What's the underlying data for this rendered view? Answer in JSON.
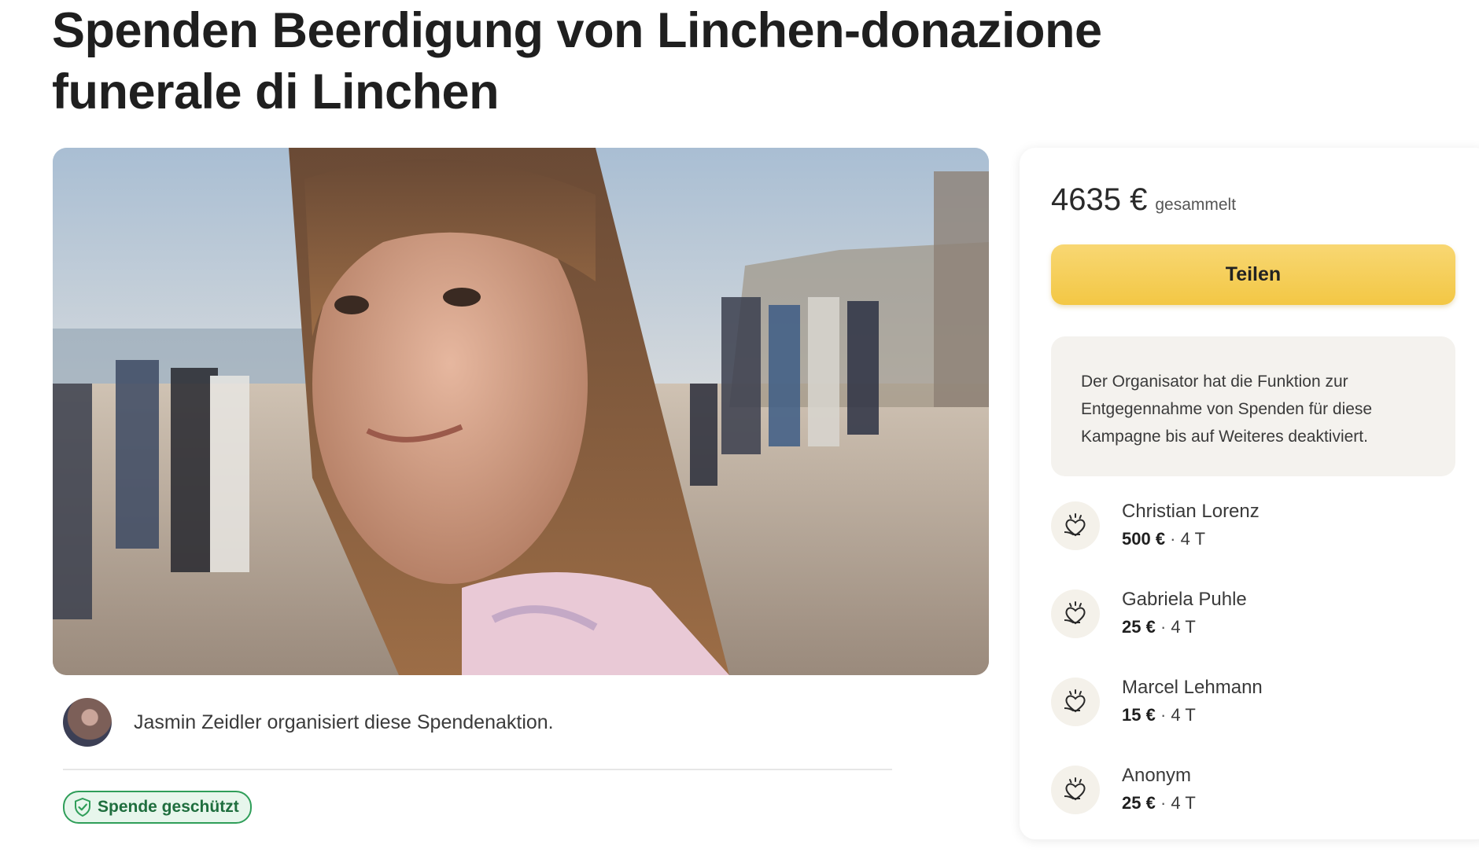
{
  "page": {
    "title": "Spenden Beerdigung von Linchen-donazione funerale di Linchen"
  },
  "organizer": {
    "text": "Jasmin Zeidler organisiert diese Spendenaktion."
  },
  "badge": {
    "label": "Spende geschützt",
    "icon": "shield-icon"
  },
  "sidebar": {
    "amount": "4635 €",
    "amount_label": "gesammelt",
    "share_label": "Teilen",
    "notice": "Der Organisator hat die Funktion zur Entgegennahme von Spenden für diese Kampagne bis auf Weiteres deaktiviert."
  },
  "donations": [
    {
      "name": "Christian Lorenz",
      "amount": "500 €",
      "sep": " · ",
      "time": "4 T",
      "icon": "donation-heart-icon"
    },
    {
      "name": "Gabriela Puhle",
      "amount": "25 €",
      "sep": " · ",
      "time": "4 T",
      "icon": "donation-heart-icon"
    },
    {
      "name": "Marcel Lehmann",
      "amount": "15 €",
      "sep": " · ",
      "time": "4 T",
      "icon": "donation-heart-icon"
    },
    {
      "name": "Anonym",
      "amount": "25 €",
      "sep": " · ",
      "time": "4 T",
      "icon": "donation-heart-icon"
    }
  ],
  "colors": {
    "share_button": "#f3c744",
    "badge_green": "#2f9e59",
    "notice_bg": "#f4f2ee"
  }
}
